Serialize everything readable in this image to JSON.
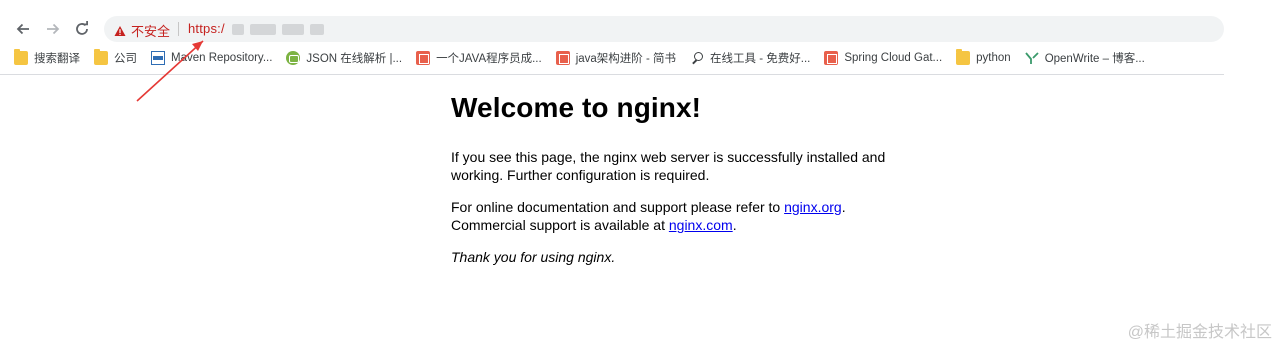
{
  "nav": {
    "back_icon": "arrow-left-icon",
    "forward_icon": "arrow-right-icon",
    "reload_icon": "reload-icon"
  },
  "omnibox": {
    "security_label": "不安全",
    "url_prefix": "https:/",
    "warning_icon": "warning-triangle-icon",
    "warning_color": "#c5221f"
  },
  "bookmarks": [
    {
      "label": "搜索翻译",
      "icon": "folder-icon"
    },
    {
      "label": "公司",
      "icon": "folder-icon"
    },
    {
      "label": "Maven Repository...",
      "icon": "maven-icon"
    },
    {
      "label": "JSON 在线解析 |...",
      "icon": "json-icon"
    },
    {
      "label": "一个JAVA程序员成...",
      "icon": "jianshu-icon"
    },
    {
      "label": "java架构进阶 - 简书",
      "icon": "jianshu-icon"
    },
    {
      "label": "在线工具 - 免费好...",
      "icon": "search-icon"
    },
    {
      "label": "Spring Cloud Gat...",
      "icon": "jianshu-icon"
    },
    {
      "label": "python",
      "icon": "folder-icon"
    },
    {
      "label": "OpenWrite – 博客...",
      "icon": "openwrite-icon"
    }
  ],
  "page": {
    "title": "Welcome to nginx!",
    "para1": "If you see this page, the nginx web server is successfully installed and working. Further configuration is required.",
    "para2_text1": "For online documentation and support please refer to ",
    "para2_link1": "nginx.org",
    "para2_text2": ".",
    "para2_text3": "Commercial support is available at ",
    "para2_link2": "nginx.com",
    "para2_text4": ".",
    "thanks": "Thank you for using nginx.",
    "link_color": "#0000ee"
  },
  "annotation": {
    "arrow_color": "#e53935"
  },
  "watermark": "@稀土掘金技术社区"
}
